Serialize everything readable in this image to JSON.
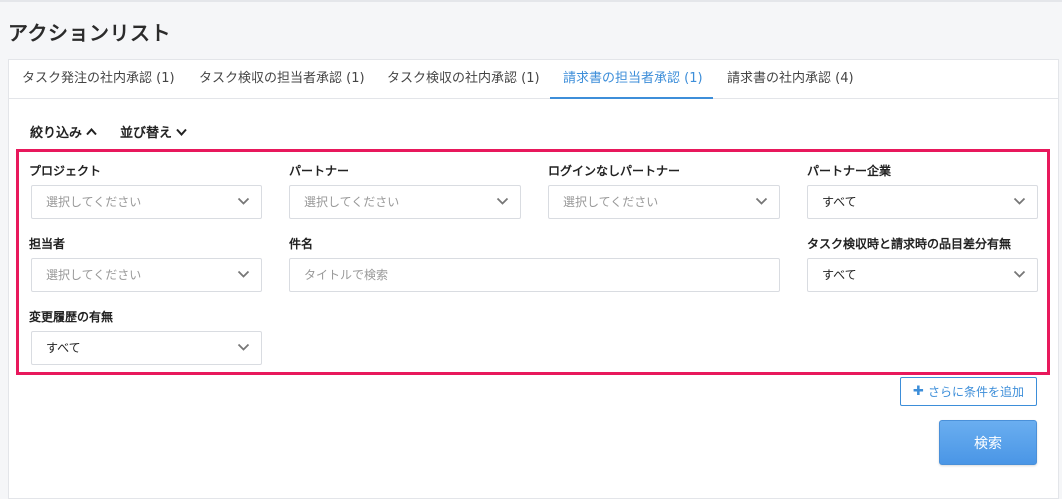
{
  "page": {
    "title": "アクションリスト"
  },
  "tabs": [
    {
      "label": "タスク発注の社内承認 (1)",
      "active": false
    },
    {
      "label": "タスク検収の担当者承認 (1)",
      "active": false
    },
    {
      "label": "タスク検収の社内承認 (1)",
      "active": false
    },
    {
      "label": "請求書の担当者承認 (1)",
      "active": true
    },
    {
      "label": "請求書の社内承認 (4)",
      "active": false
    }
  ],
  "toggles": {
    "filter_label": "絞り込み",
    "sort_label": "並び替え"
  },
  "filters": {
    "project": {
      "label": "プロジェクト",
      "placeholder": "選択してください"
    },
    "partner": {
      "label": "パートナー",
      "placeholder": "選択してください"
    },
    "no_login_partner": {
      "label": "ログインなしパートナー",
      "placeholder": "選択してください"
    },
    "partner_company": {
      "label": "パートナー企業",
      "value": "すべて"
    },
    "assignee": {
      "label": "担当者",
      "placeholder": "選択してください"
    },
    "subject": {
      "label": "件名",
      "placeholder": "タイトルで検索"
    },
    "item_diff": {
      "label": "タスク検収時と請求時の品目差分有無",
      "value": "すべて"
    },
    "change_history": {
      "label": "変更履歴の有無",
      "value": "すべて"
    }
  },
  "actions": {
    "add_condition_label": "さらに条件を追加",
    "search_label": "検索"
  },
  "colors": {
    "accent": "#3d8ed9",
    "highlight_border": "#e8185c",
    "primary_button": "#5aa2ec"
  },
  "icons": {
    "chevron": "chevron-down-icon",
    "toggle_chevron": "chevron-up-icon",
    "plus": "plus-icon"
  }
}
